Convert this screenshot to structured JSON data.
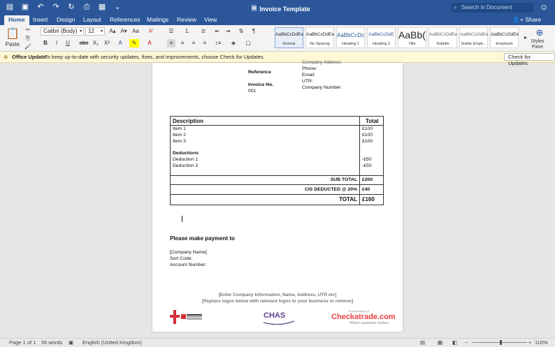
{
  "titlebar": {
    "doc_title": "Invoice Template",
    "search_placeholder": "Search in Document"
  },
  "tabs": [
    "Home",
    "Insert",
    "Design",
    "Layout",
    "References",
    "Mailings",
    "Review",
    "View"
  ],
  "share_label": "Share",
  "ribbon": {
    "paste_label": "Paste",
    "font_name": "Calibri (Body)",
    "font_size": "12",
    "styles": [
      {
        "preview": "AaBbCcDdEe",
        "name": "Normal"
      },
      {
        "preview": "AaBbCcDdEe",
        "name": "No Spacing"
      },
      {
        "preview": "AaBbCcDc",
        "name": "Heading 1"
      },
      {
        "preview": "AaBbCcDdE",
        "name": "Heading 2"
      },
      {
        "preview": "AaBb(",
        "name": "Title"
      },
      {
        "preview": "AaBbCcDdEe",
        "name": "Subtitle"
      },
      {
        "preview": "AaBbCcDdEe",
        "name": "Subtle Emph..."
      },
      {
        "preview": "AaBbCcDdEe",
        "name": "Emphasis"
      }
    ],
    "styles_pane_label": "Styles Pane"
  },
  "notify": {
    "title": "Office Update",
    "message": "To keep up-to-date with security updates, fixes, and improvements, choose Check for Updates.",
    "button": "Check for Updates"
  },
  "document": {
    "company_address": "Company Address:",
    "reference_label": "Reference",
    "phone": "Phone:",
    "email": "Email:",
    "utr": "UTR:",
    "invoice_no_label": "Invoice No.",
    "invoice_no": "001",
    "company_number": "Company Number:",
    "table": {
      "header_desc": "Description",
      "header_total": "Total",
      "items": [
        "Item 1",
        "Item 2",
        "Item 3"
      ],
      "item_totals": [
        "£100",
        "£100",
        "£100"
      ],
      "deductions_label": "Deductions",
      "deductions": [
        "Deduction 1",
        "Deduction 2"
      ],
      "deduction_totals": [
        "-£50",
        "-£50"
      ],
      "sub_total_label": "SUB TOTAL",
      "sub_total": "£200",
      "cis_label": "CIS DEDUCTED @ 20%",
      "cis": "£40",
      "total_label": "TOTAL",
      "total": "£160"
    },
    "payment_heading": "Please make payment to",
    "company_name": "[Company Name]",
    "sort_code": "Sort Code:",
    "account_number": "Account Number:",
    "footer_line1": "[Enter Company Information, Name, Address, UTR etc]",
    "footer_line2": "[Replace logos below with relevant logos to your business or remove]",
    "logo_chas": "CHAS",
    "logo_checkatrade": "Checkatrade.com",
    "logo_checkatrade_tag": "Where reputation matters",
    "logo_checkatrade_proud": "Proud members of"
  },
  "status": {
    "page": "Page 1 of 1",
    "words": "56 words",
    "language": "English (United Kingdom)",
    "zoom": "110%"
  },
  "colors": {
    "word_blue": "#2b579a",
    "notify_bg": "#fff8d6",
    "nicc_red": "#d6303a",
    "chas_purple": "#5b3f8a",
    "checkatrade_red": "#e8423b"
  }
}
